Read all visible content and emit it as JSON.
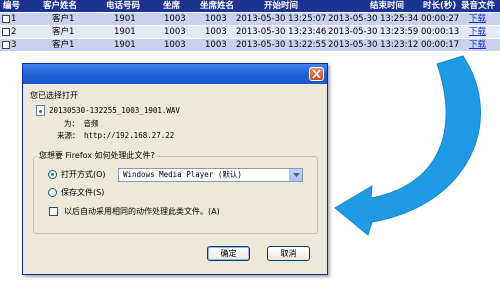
{
  "table": {
    "headers": [
      "编号",
      "客户姓名",
      "电话号码",
      "坐席",
      "坐席姓名",
      "开始时间",
      "结束时间",
      "时长(秒)",
      "录音文件"
    ],
    "rows": [
      [
        "1",
        "客户1",
        "1901",
        "1003",
        "1003",
        "2013-05-30 13:25:07",
        "2013-05-30 13:25:34",
        "00:00:27",
        "下载"
      ],
      [
        "2",
        "客户1",
        "1901",
        "1003",
        "1003",
        "2013-05-30 13:23:46",
        "2013-05-30 13:23:59",
        "00:00:13",
        "下载"
      ],
      [
        "3",
        "客户1",
        "1901",
        "1003",
        "1003",
        "2013-05-30 13:22:55",
        "2013-05-30 13:23:12",
        "00:00:17",
        "下载"
      ]
    ]
  },
  "dialog": {
    "heading": "您已选择打开",
    "filename": "20130530-132255_1003_1901.WAV",
    "type_line": "为： 音频",
    "source_line": "来源： http://192.168.27.22",
    "question": "您想要 Firefox 如何处理此文件?",
    "open_with_label": "打开方式(O)",
    "open_with_value": "Windows Media Player (默认)",
    "save_label": "保存文件(S)",
    "auto_label": "以后自动采用相同的动作处理此类文件。(A)",
    "ok_label": "确定",
    "cancel_label": "取消"
  },
  "colors": {
    "header_bg": "#1d3390",
    "row_odd": "#c9d1f1",
    "row_even": "#e4e8f8",
    "arrow": "#1e9be4",
    "titlebar": "#1f5fd6"
  }
}
